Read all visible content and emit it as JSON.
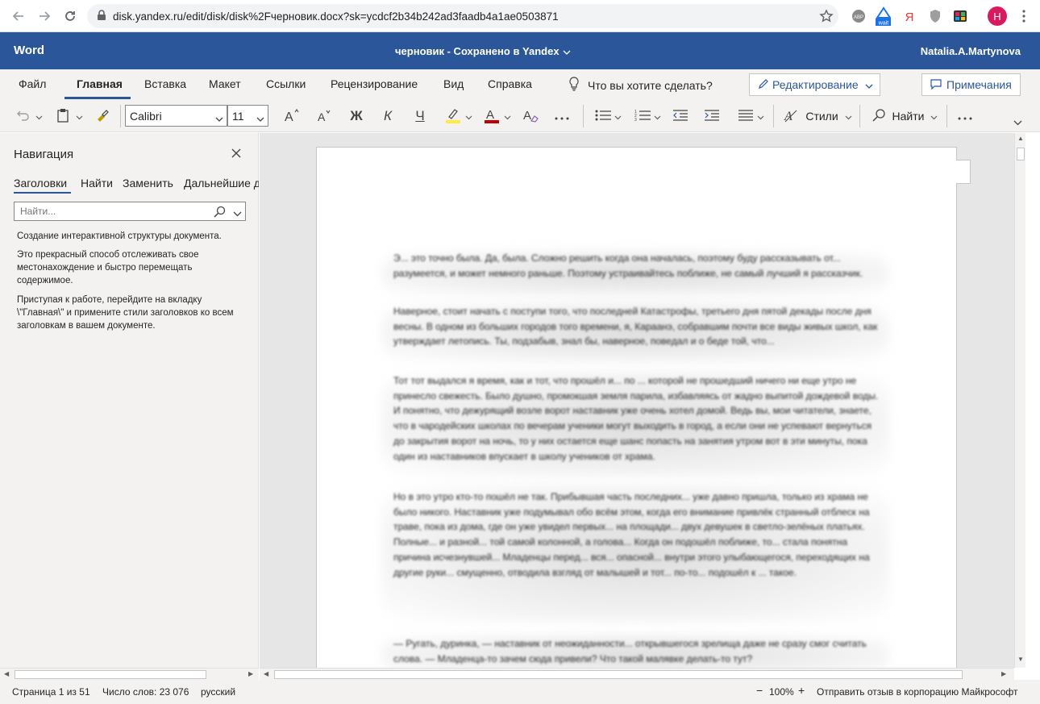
{
  "browser": {
    "url": "disk.yandex.ru/edit/disk/disk%2Fчерновик.docx?sk=ycdcf2b34b242ad3faadb4a1ae0503871",
    "extensions": [
      "ABP",
      "wait",
      "Я",
      "shield",
      "tv",
      "H"
    ],
    "profile_initial": "H"
  },
  "titlebar": {
    "app_name": "Word",
    "doc_title": "черновик  -  Сохранено в Yandex",
    "user": "Natalia.A.Martynova"
  },
  "ribbon": {
    "tabs": [
      "Файл",
      "Главная",
      "Вставка",
      "Макет",
      "Ссылки",
      "Рецензирование",
      "Вид",
      "Справка"
    ],
    "active_tab": "Главная",
    "tell_me": "Что вы хотите сделать?",
    "editing_label": "Редактирование",
    "comments_label": "Примечания"
  },
  "toolbar": {
    "font_name": "Calibri",
    "font_size": "11",
    "bold_glyph": "Ж",
    "italic_glyph": "К",
    "underline_glyph": "Ч",
    "styles_label": "Стили",
    "find_label": "Найти",
    "highlight_color": "#ffeb3b",
    "font_color": "#c00000",
    "accent": "#2b579a"
  },
  "navigation": {
    "title": "Навигация",
    "tabs": [
      "Заголовки",
      "Найти",
      "Заменить",
      "Дальнейшие д"
    ],
    "search_placeholder": "Найти...",
    "text1": "Создание интерактивной структуры документа.",
    "text2": "Это прекрасный способ отслеживать свое местонахождение и быстро перемещать содержимое.",
    "text3": "Приступая к работе, перейдите на вкладку \\\"Главная\\\" и примените стили заголовков ко всем заголовкам в вашем документе."
  },
  "document": {
    "paragraphs": [
      "Э... это точно была. Да, была. Сложно решить когда она началась, поэтому буду рассказывать от... разумеется, и может немного раньше. Поэтому устраивайтесь поближе, не самый лучший я рассказчик.",
      "Наверное, стоит начать с поступи того, что последней Катастрофы, третьего дня пятой декады после дня весны. В одном из больших городов того времени, я, Караанэ, собравшим почти все виды живых школ, как утверждает летопись. Ты, подзабыв, знал бы, наверное, поведал и о беде той, что...",
      "Тот тот выдался я время, как и тот, что прошёл и... по ... которой не прошедший ничего ни еще утро не принесло свежесть. Было душно, промокшая земля парила, избавляясь от жадно выпитой дождевой воды. И понятно, что дежурящий возле ворот наставник уже очень хотел домой. Ведь вы, мои читатели, знаете, что в чародейских школах по вечерам ученики могут выходить в город, а если они не успевают вернуться до закрытия ворот на ночь, то у них остается еще шанс попасть на занятия утром вот в эти минуты, пока один из наставников впускает в школу учеников от храма.",
      "Но в это утро кто-то пошёл не так. Прибывшая часть последних... уже давно пришла, только из храма не было никого. Наставник уже подумывал обо всём этом, когда его внимание привлёк странный отблеск на траве, пока из дома, где он уже увидел первых... на площади... двух девушек в светло-зелёных платьях. Полные... и разной... той самой колонной, а голова... Когда он подошёл поближе, то... стала понятна причина исчезнувшей... Младенцы перед... вся... опасной... внутри этого улыбающегося, переходящих на другие руки... смущенно, отводила взгляд от малышей и тот... по-то... подошёл к ... такое.",
      "— Ругать, дуринка, — наставник от неожиданности... открывшегося зрелища даже не сразу смог считать слова. — Младенца-то зачем сюда привели? Что такой малявке делать-то тут?"
    ]
  },
  "status": {
    "page": "Страница 1 из 51",
    "words": "Число слов: 23 076",
    "language": "русский",
    "zoom": "100%",
    "feedback": "Отправить отзыв в корпорацию Майкрософт"
  }
}
